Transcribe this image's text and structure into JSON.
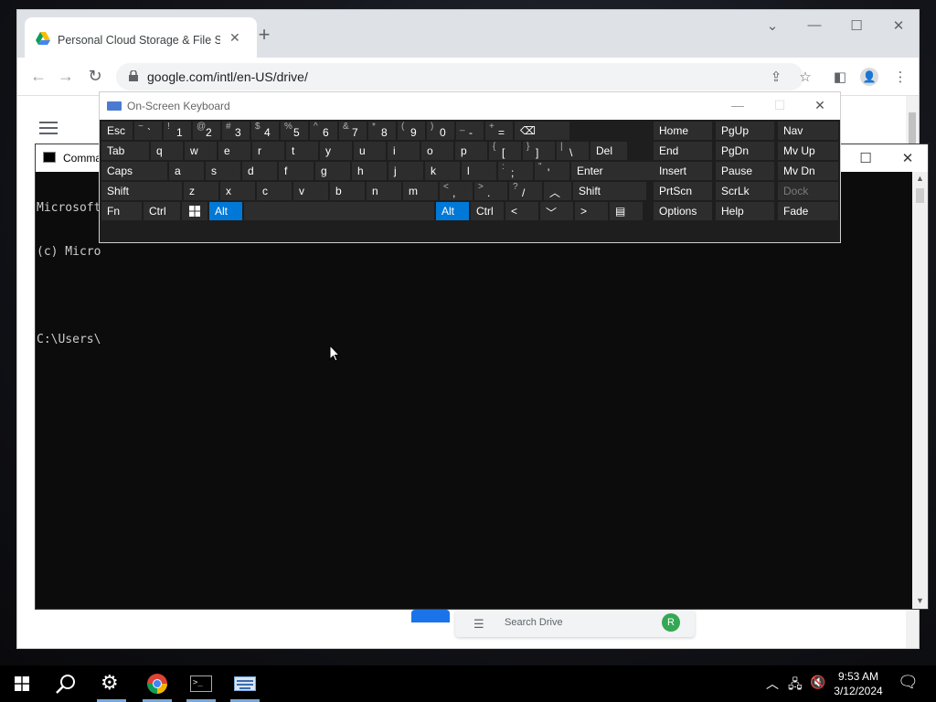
{
  "chrome": {
    "tab_title": "Personal Cloud Storage & File Sh",
    "url": "google.com/intl/en-US/drive/",
    "drive_search_placeholder": "Search Drive",
    "drive_avatar_letter": "R"
  },
  "cmd": {
    "title": "Comma",
    "lines": [
      "Microsoft",
      "(c) Micro",
      "",
      "C:\\Users\\"
    ]
  },
  "osk": {
    "title": "On-Screen Keyboard",
    "rows": {
      "r1": [
        {
          "t": "lbl",
          "label": "Esc"
        },
        {
          "t": "dual",
          "up": "~",
          "lo": "`"
        },
        {
          "t": "dual",
          "up": "!",
          "lo": "1"
        },
        {
          "t": "dual",
          "up": "@",
          "lo": "2"
        },
        {
          "t": "dual",
          "up": "#",
          "lo": "3"
        },
        {
          "t": "dual",
          "up": "$",
          "lo": "4"
        },
        {
          "t": "dual",
          "up": "%",
          "lo": "5"
        },
        {
          "t": "dual",
          "up": "^",
          "lo": "6"
        },
        {
          "t": "dual",
          "up": "&",
          "lo": "7"
        },
        {
          "t": "dual",
          "up": "*",
          "lo": "8"
        },
        {
          "t": "dual",
          "up": "(",
          "lo": "9"
        },
        {
          "t": "dual",
          "up": ")",
          "lo": "0"
        },
        {
          "t": "dual",
          "up": "_",
          "lo": "-"
        },
        {
          "t": "dual",
          "up": "+",
          "lo": "="
        },
        {
          "t": "icon",
          "label": "⌫",
          "name": "backspace-icon"
        }
      ],
      "r2": [
        {
          "t": "lbl",
          "label": "Tab"
        },
        {
          "t": "lbl",
          "label": "q"
        },
        {
          "t": "lbl",
          "label": "w"
        },
        {
          "t": "lbl",
          "label": "e"
        },
        {
          "t": "lbl",
          "label": "r"
        },
        {
          "t": "lbl",
          "label": "t"
        },
        {
          "t": "lbl",
          "label": "y"
        },
        {
          "t": "lbl",
          "label": "u"
        },
        {
          "t": "lbl",
          "label": "i"
        },
        {
          "t": "lbl",
          "label": "o"
        },
        {
          "t": "lbl",
          "label": "p"
        },
        {
          "t": "dual",
          "up": "{",
          "lo": "["
        },
        {
          "t": "dual",
          "up": "}",
          "lo": "]"
        },
        {
          "t": "dual",
          "up": "|",
          "lo": "\\"
        },
        {
          "t": "lbl",
          "label": "Del"
        }
      ],
      "r3": [
        {
          "t": "lbl",
          "label": "Caps"
        },
        {
          "t": "lbl",
          "label": "a"
        },
        {
          "t": "lbl",
          "label": "s"
        },
        {
          "t": "lbl",
          "label": "d"
        },
        {
          "t": "lbl",
          "label": "f"
        },
        {
          "t": "lbl",
          "label": "g"
        },
        {
          "t": "lbl",
          "label": "h"
        },
        {
          "t": "lbl",
          "label": "j"
        },
        {
          "t": "lbl",
          "label": "k"
        },
        {
          "t": "lbl",
          "label": "l"
        },
        {
          "t": "dual",
          "up": ":",
          "lo": ";"
        },
        {
          "t": "dual",
          "up": "\"",
          "lo": "'"
        },
        {
          "t": "lbl",
          "label": "Enter"
        }
      ],
      "r4": [
        {
          "t": "lbl",
          "label": "Shift"
        },
        {
          "t": "lbl",
          "label": "z"
        },
        {
          "t": "lbl",
          "label": "x"
        },
        {
          "t": "lbl",
          "label": "c"
        },
        {
          "t": "lbl",
          "label": "v"
        },
        {
          "t": "lbl",
          "label": "b"
        },
        {
          "t": "lbl",
          "label": "n"
        },
        {
          "t": "lbl",
          "label": "m"
        },
        {
          "t": "dual",
          "up": "<",
          "lo": ","
        },
        {
          "t": "dual",
          "up": ">",
          "lo": "."
        },
        {
          "t": "dual",
          "up": "?",
          "lo": "/"
        },
        {
          "t": "icon",
          "label": "︿",
          "name": "arrow-up-icon"
        },
        {
          "t": "lbl",
          "label": "Shift"
        }
      ],
      "r5": [
        {
          "t": "lbl",
          "label": "Fn"
        },
        {
          "t": "lbl",
          "label": "Ctrl"
        },
        {
          "t": "icon",
          "label": "",
          "name": "windows-key-icon"
        },
        {
          "t": "lbl",
          "label": "Alt",
          "active": true
        },
        {
          "t": "lbl",
          "label": ""
        },
        {
          "t": "lbl",
          "label": "Alt",
          "active": true
        },
        {
          "t": "lbl",
          "label": "Ctrl"
        },
        {
          "t": "icon",
          "label": "<",
          "name": "arrow-left-icon"
        },
        {
          "t": "icon",
          "label": "﹀",
          "name": "arrow-down-icon"
        },
        {
          "t": "icon",
          "label": ">",
          "name": "arrow-right-icon"
        },
        {
          "t": "icon",
          "label": "▤",
          "name": "menu-key-icon"
        }
      ]
    },
    "nav": [
      [
        "Home",
        "PgUp",
        "Nav"
      ],
      [
        "End",
        "PgDn",
        "Mv Up"
      ],
      [
        "Insert",
        "Pause",
        "Mv Dn"
      ],
      [
        "PrtScn",
        "ScrLk",
        "Dock"
      ],
      [
        "Options",
        "Help",
        "Fade"
      ]
    ]
  },
  "taskbar": {
    "time": "9:53 AM",
    "date": "3/12/2024"
  },
  "colors": {
    "osk_active": "#0078d7",
    "osk_key": "#2d2d2d",
    "taskbar_underline": "#7aa7d8"
  }
}
